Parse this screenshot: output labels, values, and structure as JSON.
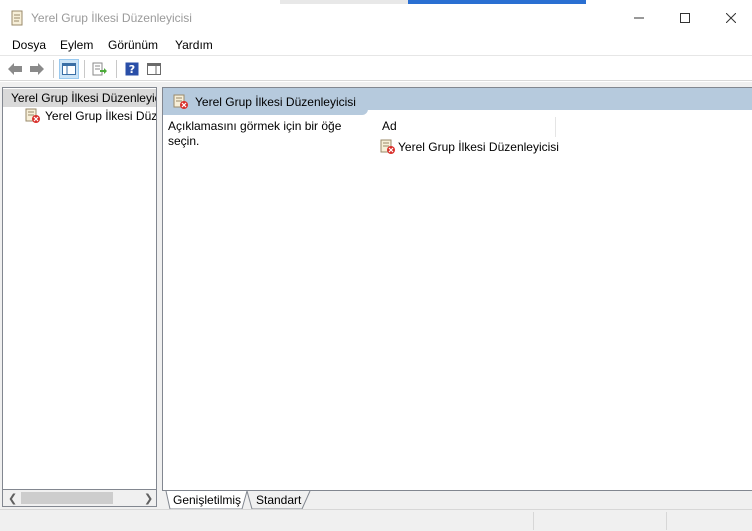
{
  "window": {
    "title": "Yerel Grup İlkesi Düzenleyicisi"
  },
  "menu": {
    "items": [
      "Dosya",
      "Eylem",
      "Görünüm",
      "Yardım"
    ]
  },
  "toolbar": {
    "buttons": [
      "back-arrow-icon",
      "forward-arrow-icon",
      "show-hide-console-tree-icon",
      "export-list-icon",
      "help-icon",
      "show-hide-action-pane-icon"
    ]
  },
  "tree": {
    "root_label": "Yerel Grup İlkesi Düzenleyicisi",
    "child_label": "Yerel Grup İlkesi Düzenleyicisi"
  },
  "details": {
    "header_title": "Yerel Grup İlkesi Düzenleyicisi",
    "description_line1": "Açıklamasını görmek için bir öğe",
    "description_line2": "seçin.",
    "column_name": "Ad",
    "items": [
      "Yerel Grup İlkesi Düzenleyicisi"
    ]
  },
  "tabs": {
    "extended": "Genişletilmiş",
    "standard": "Standart"
  },
  "colors": {
    "header_blue": "#b6cadd",
    "selection_gray": "#d9d9d9",
    "frame_gray": "#f0f0f0"
  }
}
